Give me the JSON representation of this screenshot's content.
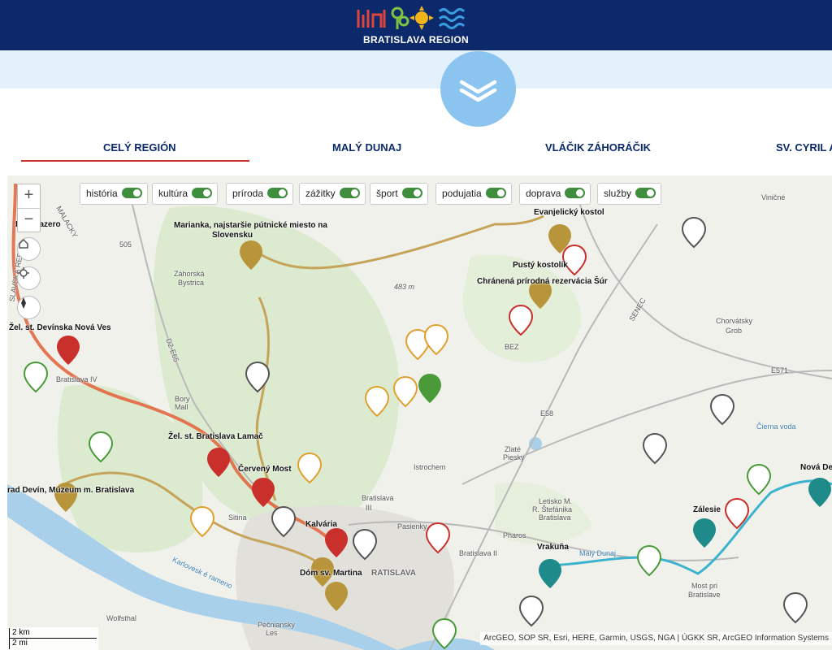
{
  "header": {
    "logo_text": "BRATISLAVA REGION"
  },
  "tabs": [
    {
      "label": "CELÝ REGIÓN",
      "active": true
    },
    {
      "label": "MALÝ DUNAJ",
      "active": false
    },
    {
      "label": "VLÁČIK ZÁHORÁČIK",
      "active": false
    },
    {
      "label": "SV. CYRIL A M",
      "active": false
    }
  ],
  "filters": [
    {
      "label": "história",
      "on": true
    },
    {
      "label": "kultúra",
      "on": true
    },
    {
      "label": "príroda",
      "on": true
    },
    {
      "label": "zážitky",
      "on": true
    },
    {
      "label": "šport",
      "on": true
    },
    {
      "label": "podujatia",
      "on": true
    },
    {
      "label": "doprava",
      "on": true
    },
    {
      "label": "služby",
      "on": true
    }
  ],
  "map_controls": {
    "zoom_in": "+",
    "zoom_out": "−"
  },
  "places": {
    "devinske_jazero": "D. ke jazero",
    "marianka": "Marianka, najstaršie pútnické miesto na",
    "marianka2": "Slovensku",
    "evanjelicky": "Evanjelický kostol",
    "pusty": "Pustý kostolík",
    "sur": "Chránená prírodná rezervácia Šúr",
    "devinska_nova_ves": "Žel. st. Devínska Nová Ves",
    "lamac": "Žel. st. Bratislava Lamač",
    "cerveny_most": "Červený Most",
    "devin": "rad Devín, Múzeum m. Bratislava",
    "kalvaria": "Kalvária",
    "dom_martina": "Dóm sv. Martina",
    "vrakuna": "Vrakuňa",
    "zalesie": "Zálesie",
    "nova_de": "Nová De",
    "zahorska": "Záhorská",
    "bystrica": "Bystrica",
    "bratislava_iv": "Bratislava IV",
    "istrochem": "Istrochem",
    "bratislava_iii": "Bratislava",
    "bratislava_iii2": "III",
    "bratislava_ii": "Bratislava II",
    "pharos": "Pharos",
    "letisko": "Letisko M.",
    "letisko2": "R. Štefánika",
    "letisko3": "Bratislava",
    "chorvatsky": "Chorvátsky",
    "grob": "Grob",
    "vinicne": "Viničné",
    "senec": "SENEC",
    "cierna_voda": "Čierna voda",
    "maly_dunaj": "Malý Dunaj",
    "karlova": "Karlovesk é rameno",
    "bez": "BEZ",
    "sitina": "Sitina",
    "peciansky": "Pečniansky",
    "les": "Les",
    "wolfsthal": "Wolfsthal",
    "pasienky": "Pasienky",
    "zlate": "Zlaté",
    "piesky": "Piesky",
    "slavska": "SLAVSKÁ REP",
    "malacky": "MALACKY",
    "elev_483": "483 m",
    "e571": "E571",
    "e58": "E58",
    "e65": "D2-E65",
    "rd505": "505",
    "most_pri": "Most pri",
    "most_pri2": "Bratislave",
    "bory": "Bory",
    "mall": "Mall",
    "ratislava": "RATISLAVA"
  },
  "scale": {
    "km": "2 km",
    "mi": "2 mi"
  },
  "attribution": "ArcGEO, SOP SR, Esri, HERE, Garmin, USGS, NGA | ÚGKK SR, ArcGEO Information Systems",
  "colors": {
    "navy": "#0c2a6b",
    "history": "#b8953a",
    "culture": "#c9302c",
    "nature": "#4a9a3a",
    "experience": "#e0a030",
    "sport": "#1f8a8a",
    "services": "#555555",
    "toggle": "#3e8e3e"
  }
}
